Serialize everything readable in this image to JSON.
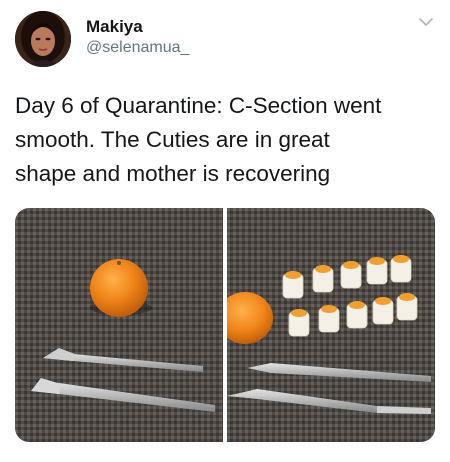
{
  "tweet": {
    "author": {
      "display_name": "Makiya",
      "handle": "@selenamua_",
      "avatar_icon": "profile-photo"
    },
    "menu_icon": "chevron-down-icon",
    "text_lines": [
      "Day 6 of Quarantine: C-Section went",
      "smooth. The Cuties are in great",
      "shape and mother is recovering"
    ],
    "media": [
      {
        "icon": "photo-whole-mandarin-with-scalpels"
      },
      {
        "icon": "photo-peeled-mandarin-segments-with-scalpels"
      }
    ]
  },
  "colors": {
    "text_primary": "#14171a",
    "text_secondary": "#657786",
    "chevron": "#aab8c2",
    "orange": "#f0841a",
    "mat": "#5a5550"
  }
}
